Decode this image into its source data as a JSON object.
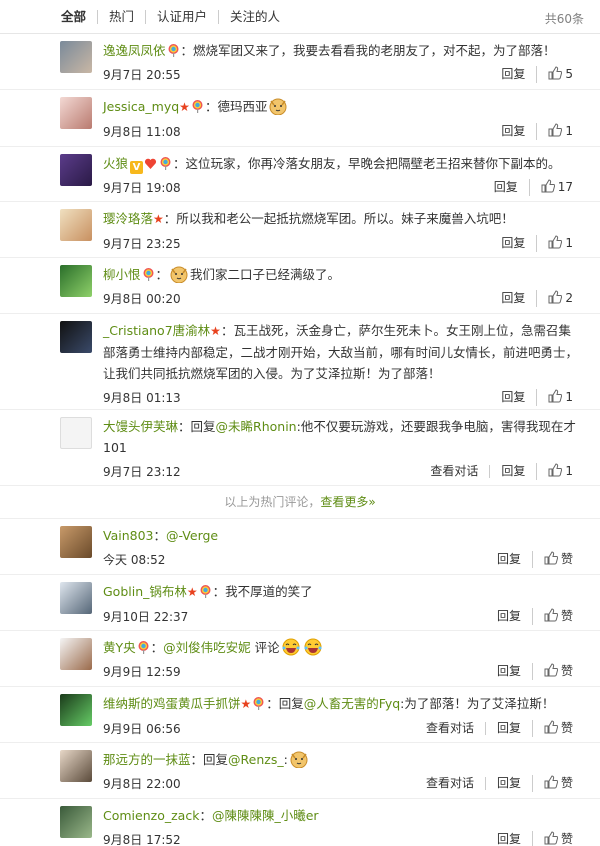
{
  "tabs": [
    "全部",
    "热门",
    "认证用户",
    "关注的人"
  ],
  "total": "共60条",
  "hot": [
    {
      "user": "逸逸凤凤依",
      "text": "：燃烧军团又来了，我要去看看我的老朋友了，对不起，为了部落！",
      "time": "9月7日 20:55",
      "reply": "回复",
      "likes": "5"
    },
    {
      "user": "Jessica_myq",
      "text": "：德玛西亚",
      "time": "9月8日 11:08",
      "reply": "回复",
      "likes": "1"
    },
    {
      "user": "火狼",
      "text": "：这位玩家，你再冷落女朋友，早晚会把隔壁老王招来替你下副本的。",
      "time": "9月7日 19:08",
      "reply": "回复",
      "likes": "17"
    },
    {
      "user": "璎泠珞落",
      "text": "：所以我和老公一起抵抗燃烧军团。所以。妹子来魔兽入坑吧！",
      "time": "9月7日 23:25",
      "reply": "回复",
      "likes": "1"
    },
    {
      "user": "柳小恨",
      "text": "：",
      "text2": "我们家二口子已经满级了。",
      "time": "9月8日 00:20",
      "reply": "回复",
      "likes": "2"
    },
    {
      "user": "_Cristiano7唐渝林",
      "text": "：瓦王战死，沃金身亡，萨尔生死未卜。女王刚上位，急需召集部落勇士维持内部稳定，二战才刚开始，大敌当前，哪有时间儿女情长，前进吧勇士，让我们共同抵抗燃烧军团的入侵。为了艾泽拉斯！为了部落！",
      "time": "9月8日 01:13",
      "reply": "回复",
      "likes": "1"
    },
    {
      "user": "大馒头伊芙琳",
      "text": "：回复",
      "at": "@未睎Rhonin",
      "text2": ":他不仅要玩游戏，还要跟我争电脑，害得我现在才101",
      "time": "9月7日 23:12",
      "view": "查看对话",
      "reply": "回复",
      "likes": "1"
    }
  ],
  "more": {
    "prefix": "以上为热门评论，",
    "link": "查看更多»"
  },
  "latest": [
    {
      "user": "Vain803",
      "text": "：",
      "at": "@-Verge",
      "time": "今天 08:52",
      "reply": "回复",
      "likes": "赞"
    },
    {
      "user": "Goblin_锅布林",
      "text": "：我不厚道的笑了",
      "time": "9月10日 22:37",
      "reply": "回复",
      "likes": "赞"
    },
    {
      "user": "黄Y央",
      "text": "：",
      "at": "@刘俊伟吃安妮",
      "text2": " 评论",
      "time": "9月9日 12:59",
      "reply": "回复",
      "likes": "赞"
    },
    {
      "user": "维纳斯的鸡蛋黄瓜手抓饼",
      "text": "：回复",
      "at": "@人畜无害的Fyq",
      "text2": ":为了部落！为了艾泽拉斯！",
      "time": "9月9日 06:56",
      "view": "查看对话",
      "reply": "回复",
      "likes": "赞"
    },
    {
      "user": "那远方的一抹蓝",
      "text": "：回复",
      "at": "@Renzs_",
      "text2": ":",
      "time": "9月8日 22:00",
      "view": "查看对话",
      "reply": "回复",
      "likes": "赞"
    },
    {
      "user": "Comienzo_zack",
      "text": "：",
      "at": "@陳陳陳陳_小曦er",
      "time": "9月8日 17:52",
      "reply": "回复",
      "likes": "赞"
    }
  ]
}
